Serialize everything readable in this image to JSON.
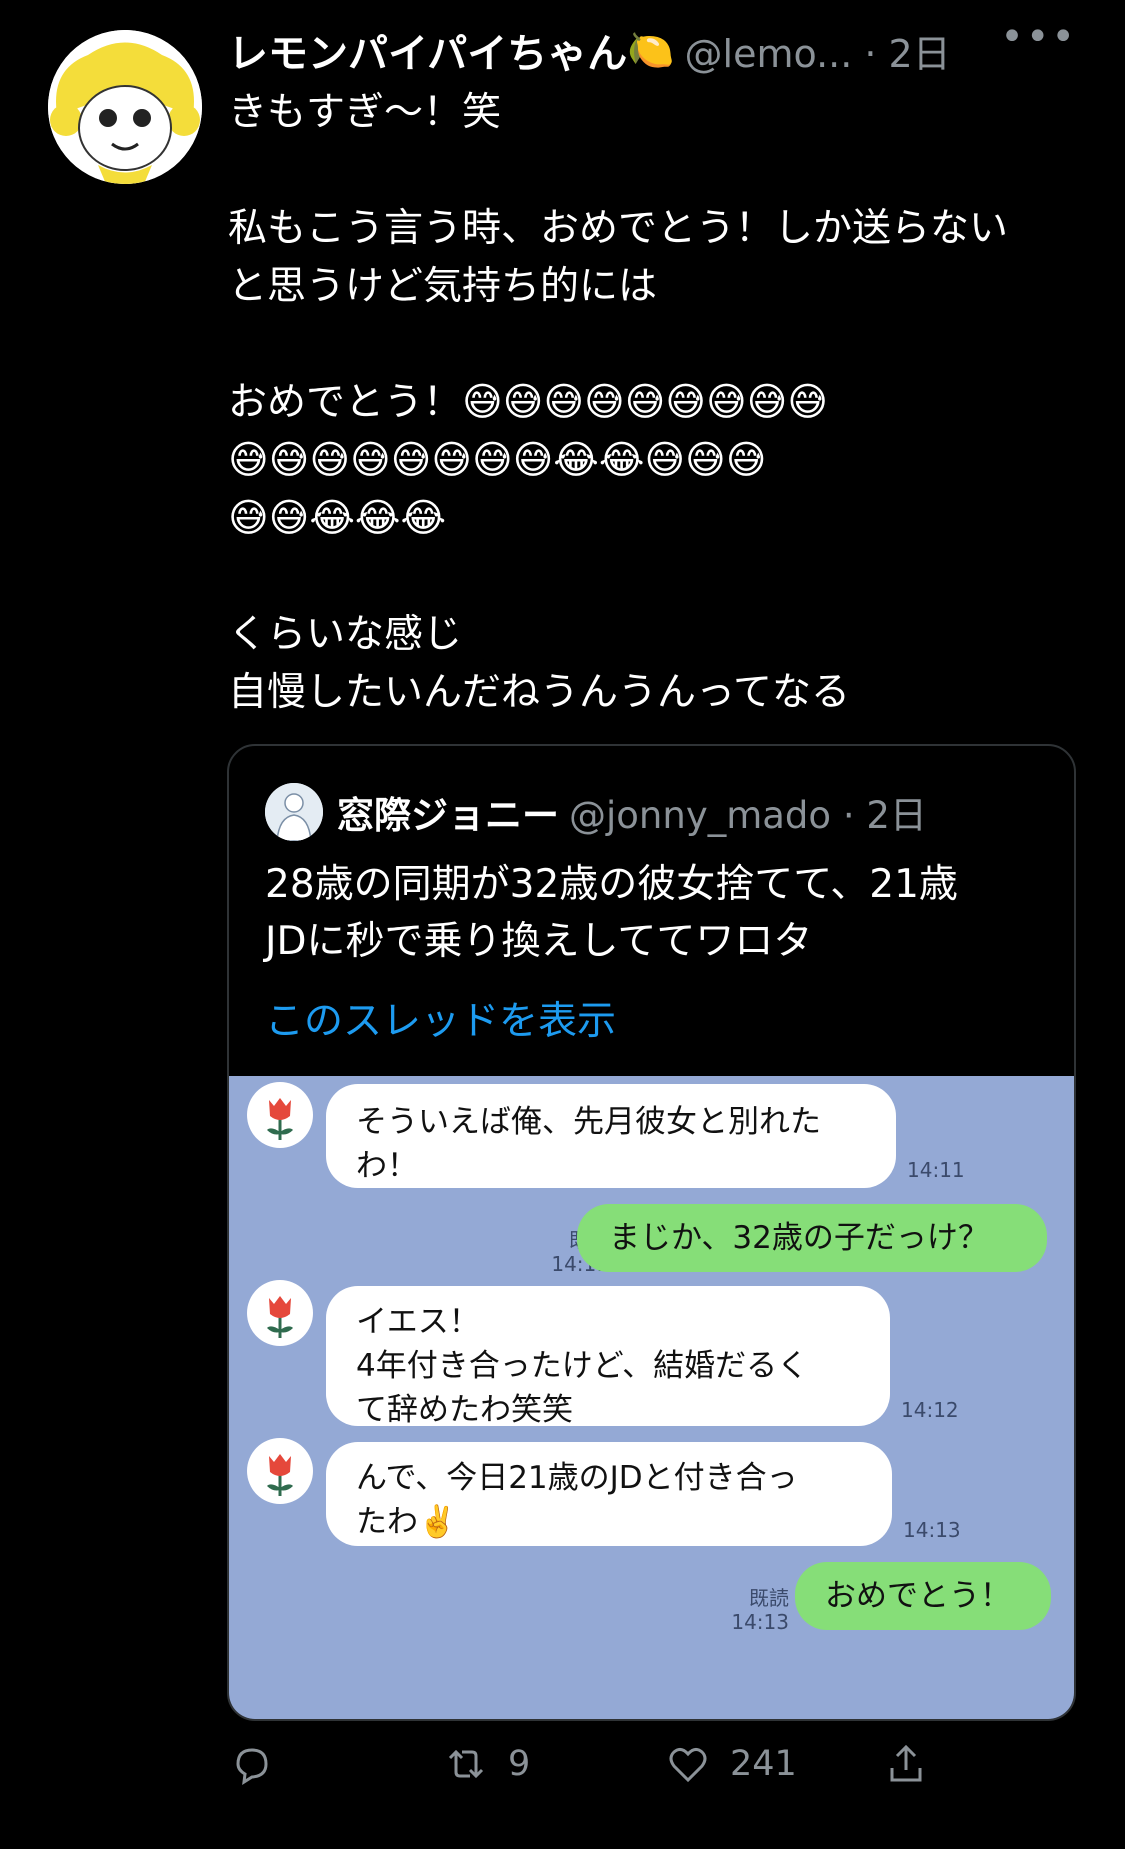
{
  "tweet": {
    "author_name": "レモンパイパイちゃん",
    "author_emoji": "🍋",
    "handle": "@lemo... · 2日",
    "more": "•••",
    "text": "きもすぎ〜！笑\n\n私もこう言う時、おめでとう！しか送らない\nと思うけど気持ち的には\n\nおめでとう！😅😅😅😅😅😅😅😅😅\n😅😅😅😅😅😅😅😅😂😂😅😅😅\n😅😅😂😂😂\n\nくらいな感じ\n自慢したいんだねうんうんってなる"
  },
  "quote": {
    "author_name": "窓際ジョニー",
    "handle": "@jonny_mado · 2日",
    "text": "28歳の同期が32歳の彼女捨てて、21歳\nJDに秒で乗り換えしててワロタ",
    "link": "このスレッドを表示"
  },
  "chat": {
    "messages": [
      {
        "text": "そういえば俺、先月彼女と別れた\nわ！",
        "time": "14:11"
      },
      {
        "read": "既読",
        "time": "14:11",
        "text": "まじか、32歳の子だっけ？"
      },
      {
        "text": "イエス！\n4年付き合ったけど、結婚だるく\nて辞めたわ笑笑",
        "time": "14:12"
      },
      {
        "text": "んで、今日21歳のJDと付き合っ\nたわ✌️",
        "time": "14:13"
      },
      {
        "read": "既読",
        "time": "14:13",
        "text": "おめでとう！"
      }
    ]
  },
  "actions": {
    "retweets": "9",
    "likes": "241"
  },
  "colors": {
    "background": "#000000",
    "link": "#1d9bf0",
    "chat_bg": "#94a9d5",
    "my_bubble": "#86de78"
  }
}
